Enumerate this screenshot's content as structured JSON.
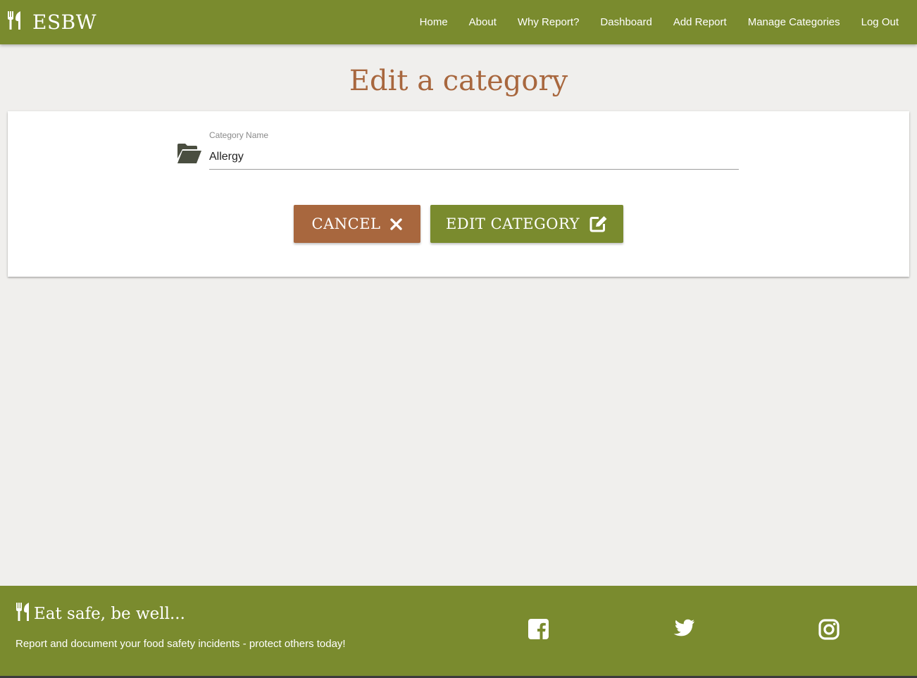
{
  "app": {
    "brand": "ESBW",
    "brand_icon": "utensils-icon"
  },
  "nav": {
    "items": [
      {
        "label": "Home"
      },
      {
        "label": "About"
      },
      {
        "label": "Why Report?"
      },
      {
        "label": "Dashboard"
      },
      {
        "label": "Add Report"
      },
      {
        "label": "Manage Categories"
      },
      {
        "label": "Log Out"
      }
    ]
  },
  "page": {
    "title": "Edit a category"
  },
  "form": {
    "field_icon": "folder-open-icon",
    "category_label": "Category Name",
    "category_value": "Allergy",
    "cancel_label": "CANCEL",
    "cancel_icon": "close-icon",
    "submit_label": "EDIT CATEGORY",
    "submit_icon": "edit-icon"
  },
  "footer": {
    "tagline": "Eat safe, be well...",
    "text": "Report and document your food safety incidents - protect others today!",
    "social": [
      "facebook-icon",
      "twitter-icon",
      "instagram-icon"
    ]
  },
  "colors": {
    "primary": "#7a8b2e",
    "accent": "#a8673e",
    "background": "#f0efed"
  }
}
